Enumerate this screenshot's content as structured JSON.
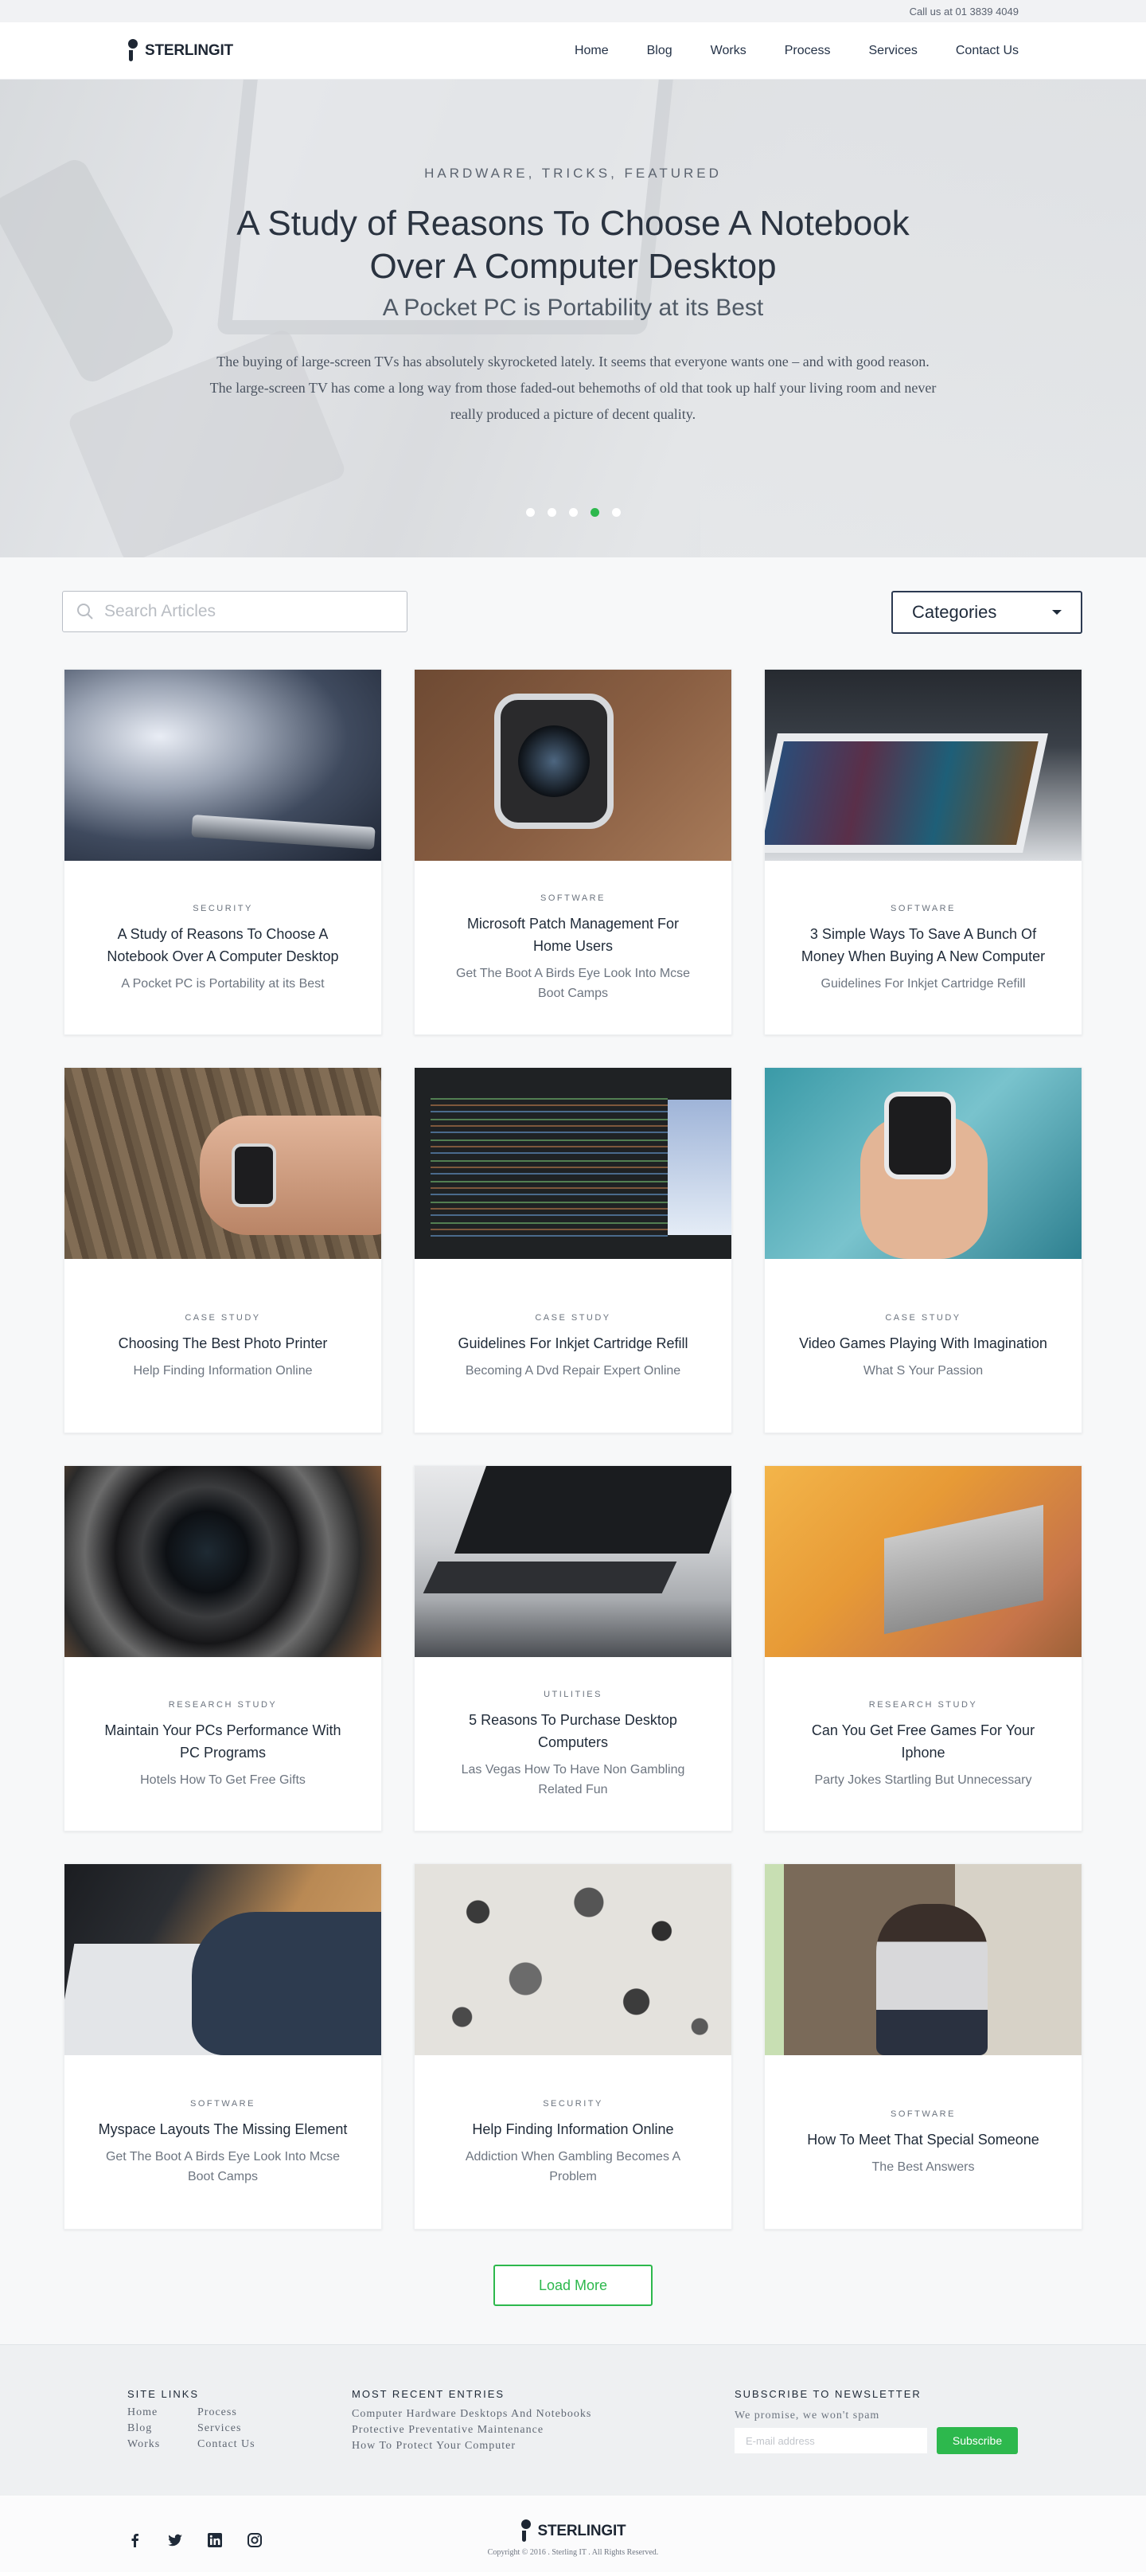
{
  "topbar": {
    "phone_text": "Call us at 01 3839 4049"
  },
  "brand": {
    "name": "STERLINGIT"
  },
  "nav": {
    "items": [
      "Home",
      "Blog",
      "Works",
      "Process",
      "Services",
      "Contact Us"
    ]
  },
  "hero": {
    "kicker": "HARDWARE, TRICKS, FEATURED",
    "title": "A Study of Reasons To Choose A Notebook Over A Computer Desktop",
    "subtitle": "A Pocket PC is Portability at its Best",
    "text": "The buying of large-screen TVs has absolutely skyrocketed lately. It seems that everyone wants one – and with good reason. The large-screen TV has come a long way from those faded-out behemoths of old that took up half your living room and never really produced a picture of decent quality.",
    "slide_count": 5,
    "active_slide": 4,
    "accent": "#2db84d"
  },
  "search": {
    "placeholder": "Search Articles",
    "value": ""
  },
  "categories": {
    "label": "Categories"
  },
  "articles": [
    {
      "category": "SECURITY",
      "title": "A Study of Reasons To Choose A Notebook Over A Computer Desktop",
      "subtitle": "A Pocket PC is Portability at its Best"
    },
    {
      "category": "SOFTWARE",
      "title": "Microsoft Patch Management For Home Users",
      "subtitle": "Get The Boot A Birds Eye Look Into Mcse Boot Camps"
    },
    {
      "category": "SOFTWARE",
      "title": "3 Simple Ways To Save A Bunch Of Money When Buying A New Computer",
      "subtitle": "Guidelines For Inkjet Cartridge Refill"
    },
    {
      "category": "CASE STUDY",
      "title": "Choosing The Best Photo Printer",
      "subtitle": "Help Finding Information Online"
    },
    {
      "category": "CASE STUDY",
      "title": "Guidelines For Inkjet Cartridge Refill",
      "subtitle": "Becoming A Dvd Repair Expert Online"
    },
    {
      "category": "CASE STUDY",
      "title": "Video Games Playing With Imagination",
      "subtitle": "What S Your Passion"
    },
    {
      "category": "RESEARCH STUDY",
      "title": "Maintain Your PCs Performance With PC Programs",
      "subtitle": "Hotels How To Get Free Gifts"
    },
    {
      "category": "UTILITIES",
      "title": "5 Reasons To Purchase Desktop Computers",
      "subtitle": "Las Vegas How To Have Non Gambling Related Fun"
    },
    {
      "category": "RESEARCH STUDY",
      "title": "Can You Get Free Games For Your Iphone",
      "subtitle": "Party Jokes Startling But Unnecessary"
    },
    {
      "category": "SOFTWARE",
      "title": "Myspace Layouts The Missing Element",
      "subtitle": "Get The Boot A Birds Eye Look Into Mcse Boot Camps"
    },
    {
      "category": "SECURITY",
      "title": "Help Finding Information Online",
      "subtitle": "Addiction When Gambling Becomes A Problem"
    },
    {
      "category": "SOFTWARE",
      "title": "How To Meet That Special Someone",
      "subtitle": "The Best Answers"
    }
  ],
  "load_more": {
    "label": "Load More"
  },
  "footer": {
    "site_links": {
      "heading": "SITE LINKS",
      "items": [
        "Home",
        "Blog",
        "Works",
        "Process",
        "Services",
        "Contact Us"
      ]
    },
    "recent": {
      "heading": "MOST RECENT ENTRIES",
      "items": [
        "Computer Hardware Desktops And Notebooks",
        "Protective Preventative Maintenance",
        "How To Protect Your Computer"
      ]
    },
    "newsletter": {
      "heading": "SUBSCRIBE TO NEWSLETTER",
      "promise": "We promise, we won't spam",
      "email_placeholder": "E-mail address",
      "button": "Subscribe"
    },
    "socials": [
      "facebook-icon",
      "twitter-icon",
      "linkedin-icon",
      "instagram-icon"
    ],
    "copyright": "Copyright © 2016 . Sterling IT . All Rights Reserved."
  }
}
